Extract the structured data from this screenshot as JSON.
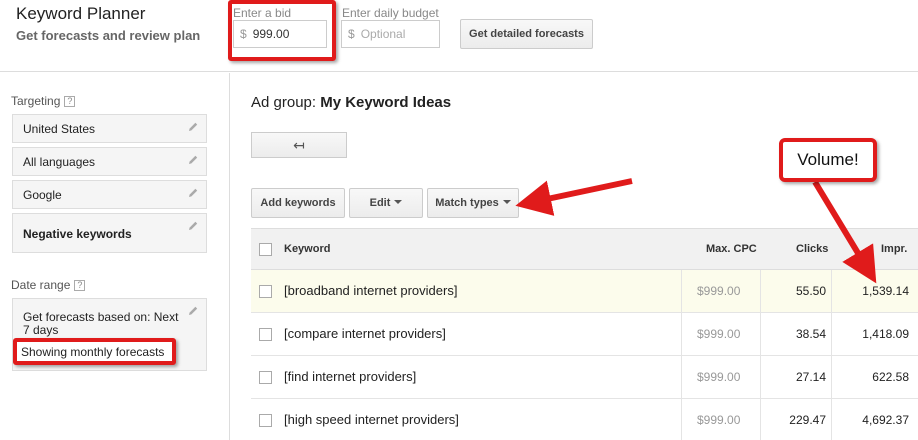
{
  "header": {
    "app_title": "Keyword Planner",
    "app_subtitle": "Get forecasts and review plan",
    "bid_label": "Enter a bid",
    "bid_currency": "$",
    "bid_value": "999.00",
    "budget_label": "Enter daily budget",
    "budget_currency": "$",
    "budget_placeholder": "Optional",
    "forecast_button": "Get detailed forecasts"
  },
  "sidebar": {
    "targeting_label": "Targeting",
    "help_glyph": "?",
    "targets": [
      "United States",
      "All languages",
      "Google",
      "Negative keywords"
    ],
    "date_range_label": "Date range",
    "date_range_text": "Get forecasts based on: Next 7 days",
    "monthly_text": "Showing monthly forecasts"
  },
  "main": {
    "ad_group_prefix": "Ad group: ",
    "ad_group_name": "My Keyword Ideas",
    "back_glyph": "↤",
    "toolbar": {
      "add_keywords": "Add keywords",
      "edit": "Edit",
      "match_types": "Match types"
    },
    "columns": [
      "Keyword",
      "Max. CPC",
      "Clicks",
      "Impr."
    ],
    "rows": [
      {
        "keyword": "[broadband internet providers]",
        "cpc": "$999.00",
        "clicks": "55.50",
        "impr": "1,539.14"
      },
      {
        "keyword": "[compare internet providers]",
        "cpc": "$999.00",
        "clicks": "38.54",
        "impr": "1,418.09"
      },
      {
        "keyword": "[find internet providers]",
        "cpc": "$999.00",
        "clicks": "27.14",
        "impr": "622.58"
      },
      {
        "keyword": "[high speed internet providers]",
        "cpc": "$999.00",
        "clicks": "229.47",
        "impr": "4,692.37"
      }
    ]
  },
  "callout": {
    "text": "Volume!"
  },
  "colors": {
    "annotation_red": "#e01b1b",
    "highlight_row": "#fcfcec"
  }
}
